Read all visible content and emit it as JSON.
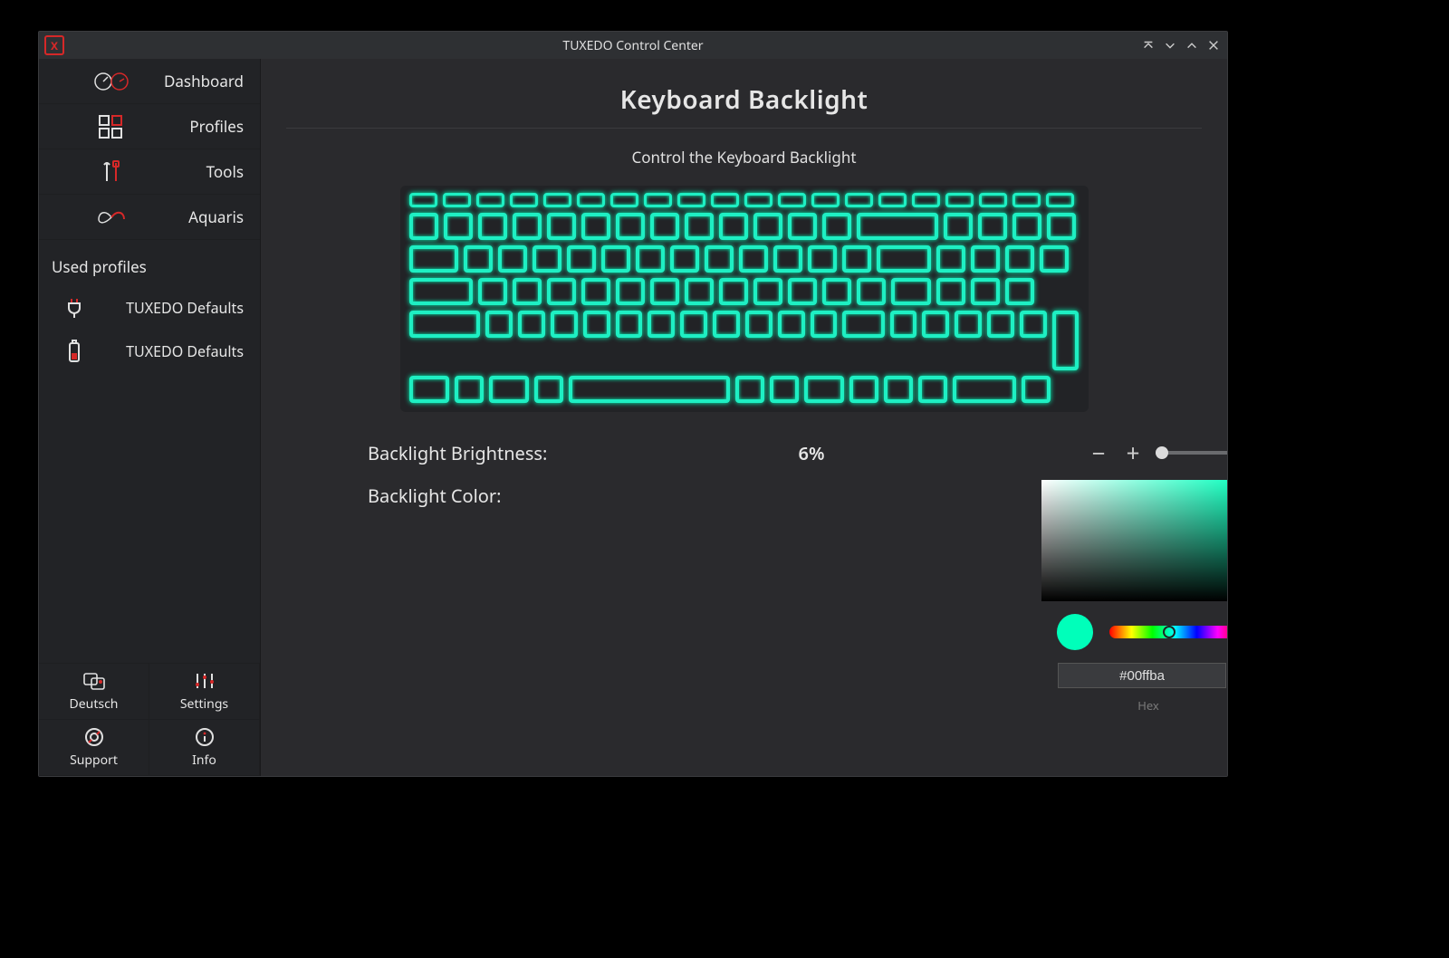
{
  "window": {
    "title": "TUXEDO Control Center"
  },
  "sidebar": {
    "nav": [
      {
        "id": "dashboard",
        "label": "Dashboard"
      },
      {
        "id": "profiles",
        "label": "Profiles"
      },
      {
        "id": "tools",
        "label": "Tools"
      },
      {
        "id": "aquaris",
        "label": "Aquaris"
      }
    ],
    "used_profiles_header": "Used profiles",
    "profiles": [
      {
        "id": "ac",
        "label": "TUXEDO Defaults"
      },
      {
        "id": "battery",
        "label": "TUXEDO Defaults"
      }
    ],
    "bottom": {
      "language": "Deutsch",
      "settings": "Settings",
      "support": "Support",
      "info": "Info"
    }
  },
  "main": {
    "title": "Keyboard Backlight",
    "subtitle": "Control the Keyboard Backlight",
    "brightness_label": "Backlight Brightness:",
    "brightness_value": "6%",
    "brightness_percent": 6,
    "color_label": "Backlight Color:",
    "hex_value": "#00ffba",
    "hex_caption": "Hex"
  },
  "colors": {
    "backlight": "#00ffba",
    "accent": "#d62828"
  }
}
